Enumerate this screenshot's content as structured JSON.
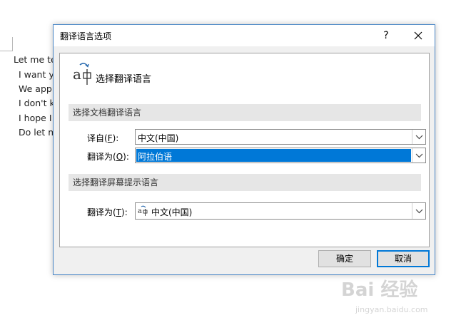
{
  "document": {
    "lines": [
      "Let me te",
      "I want yo",
      "We appr",
      "I don't k",
      "I hope I",
      "Do let m"
    ]
  },
  "dialog": {
    "title": "翻译语言选项",
    "help_label": "?",
    "close_label": "✕",
    "header_label": "选择翻译语言",
    "section_document": "选择文档翻译语言",
    "from_label_prefix": "译自(",
    "from_label_key": "F",
    "from_label_suffix": "):",
    "from_value": "中文(中国)",
    "to_label_prefix": "翻译为(",
    "to_label_key": "O",
    "to_label_suffix": "):",
    "to_value": "阿拉伯语",
    "section_screentip": "选择翻译屏幕提示语言",
    "tip_label_prefix": "翻译为(",
    "tip_label_key": "T",
    "tip_label_suffix": "):",
    "tip_value": "中文(中国)",
    "ok_label": "确定",
    "cancel_label": "取消"
  },
  "watermark": {
    "text": "Bai 经验",
    "sub": "jingyan.baidu.com"
  },
  "colors": {
    "accent": "#0078d7",
    "window_border": "#4a87c7",
    "section_bg": "#e6e6e6"
  }
}
